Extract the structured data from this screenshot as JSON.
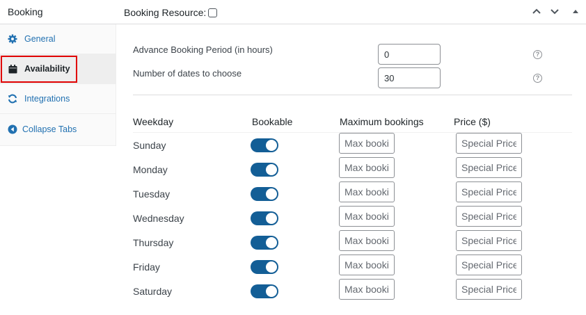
{
  "header": {
    "title": "Booking",
    "resource_label": "Booking Resource:"
  },
  "sidebar": {
    "items": [
      {
        "label": "General",
        "icon": "gear-icon"
      },
      {
        "label": "Availability",
        "icon": "calendar-icon"
      },
      {
        "label": "Integrations",
        "icon": "refresh-icon"
      },
      {
        "label": "Collapse Tabs",
        "icon": "collapse-icon"
      }
    ],
    "active": "Availability"
  },
  "fields": {
    "advance_period": {
      "label": "Advance Booking Period (in hours)",
      "value": "0"
    },
    "dates_to_choose": {
      "label": "Number of dates to choose",
      "value": "30"
    }
  },
  "table": {
    "headers": [
      "Weekday",
      "Bookable",
      "Maximum bookings",
      "Price ($)"
    ],
    "rows": [
      {
        "day": "Sunday",
        "bookable": true
      },
      {
        "day": "Monday",
        "bookable": true
      },
      {
        "day": "Tuesday",
        "bookable": true
      },
      {
        "day": "Wednesday",
        "bookable": true
      },
      {
        "day": "Thursday",
        "bookable": true
      },
      {
        "day": "Friday",
        "bookable": true
      },
      {
        "day": "Saturday",
        "bookable": true
      }
    ],
    "max_placeholder": "Max bookings",
    "price_placeholder": "Special Price"
  },
  "colors": {
    "accent": "#2271b1",
    "toggle_on": "#135e96",
    "highlight": "#e00000"
  }
}
